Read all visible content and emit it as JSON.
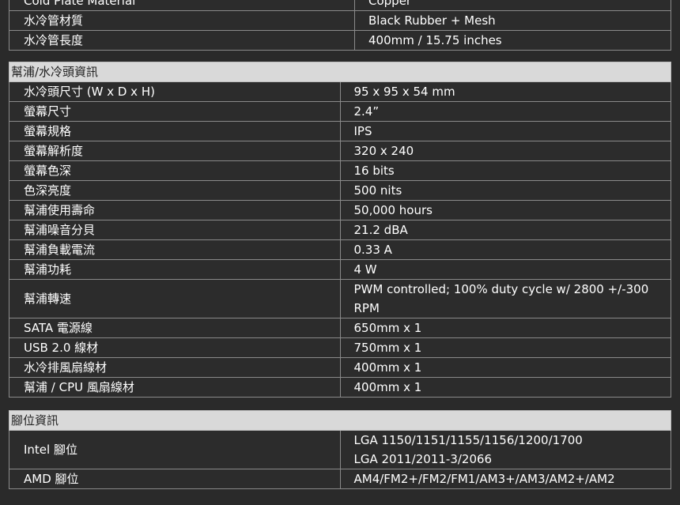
{
  "section_top": {
    "rows": [
      {
        "label": "Cold Plate Material",
        "value": "Copper"
      },
      {
        "label": "水冷管材質",
        "value": "Black Rubber + Mesh"
      },
      {
        "label": "水冷管長度",
        "value": "400mm / 15.75 inches"
      }
    ]
  },
  "section_pump": {
    "title": "幫浦/水冷頭資訊",
    "rows": [
      {
        "label": "水冷頭尺寸 (W x D x H)",
        "value": [
          "95 x 95 x 54 mm"
        ]
      },
      {
        "label": "螢幕尺寸",
        "value": [
          "2.4”"
        ]
      },
      {
        "label": "螢幕規格",
        "value": [
          "IPS"
        ]
      },
      {
        "label": "螢幕解析度",
        "value": [
          "320 x 240"
        ]
      },
      {
        "label": "螢幕色深",
        "value": [
          "16 bits"
        ]
      },
      {
        "label": "色深亮度",
        "value": [
          "500 nits"
        ]
      },
      {
        "label": "幫浦使用壽命",
        "value": [
          "50,000 hours"
        ]
      },
      {
        "label": "幫浦噪音分貝",
        "value": [
          "21.2 dBA"
        ]
      },
      {
        "label": "幫浦負載電流",
        "value": [
          "0.33 A"
        ]
      },
      {
        "label": "幫浦功耗",
        "value": [
          "4 W"
        ]
      },
      {
        "label": "幫浦轉速",
        "value": [
          "PWM controlled; 100% duty cycle w/ 2800 +/-300",
          "RPM"
        ]
      },
      {
        "label": "SATA 電源線",
        "value": [
          "650mm x 1"
        ]
      },
      {
        "label": "USB 2.0 線材",
        "value": [
          "750mm x 1"
        ]
      },
      {
        "label": "水冷排風扇線材",
        "value": [
          "400mm x 1"
        ]
      },
      {
        "label": "幫浦 / CPU 風扇線材",
        "value": [
          "400mm x 1"
        ]
      }
    ]
  },
  "section_socket": {
    "title": "腳位資訊",
    "rows": [
      {
        "label": "Intel 腳位",
        "value": [
          "LGA 1150/1151/1155/1156/1200/1700",
          "LGA 2011/2011-3/2066"
        ]
      },
      {
        "label": "AMD 腳位",
        "value": [
          "AM4/FM2+/FM2/FM1/AM3+/AM3/AM2+/AM2"
        ]
      }
    ]
  }
}
